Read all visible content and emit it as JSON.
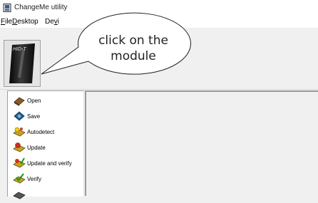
{
  "window": {
    "title": "ChangeMe utility"
  },
  "menu": {
    "file": {
      "key": "F",
      "rest": "ile"
    },
    "desktop": {
      "key": "D",
      "rest": "esktop"
    },
    "devices": {
      "pre": "De",
      "key": "v",
      "rest": "i"
    }
  },
  "toolbar": {
    "module_label": "HID-T"
  },
  "sidebar": {
    "items": [
      {
        "label": "Open",
        "icon": "open-icon"
      },
      {
        "label": "Save",
        "icon": "save-icon"
      },
      {
        "label": "Autodetect",
        "icon": "autodetect-icon"
      },
      {
        "label": "Update",
        "icon": "update-icon"
      },
      {
        "label": "Update and verify",
        "icon": "update-verify-icon"
      },
      {
        "label": "Verify",
        "icon": "verify-icon"
      }
    ]
  },
  "callout": {
    "line1": "click on the",
    "line2": "module"
  },
  "colors": {
    "callout_bg": "#ffffff",
    "module_dark": "#1a1a1a",
    "workspace_border": "#9a9a9a"
  }
}
